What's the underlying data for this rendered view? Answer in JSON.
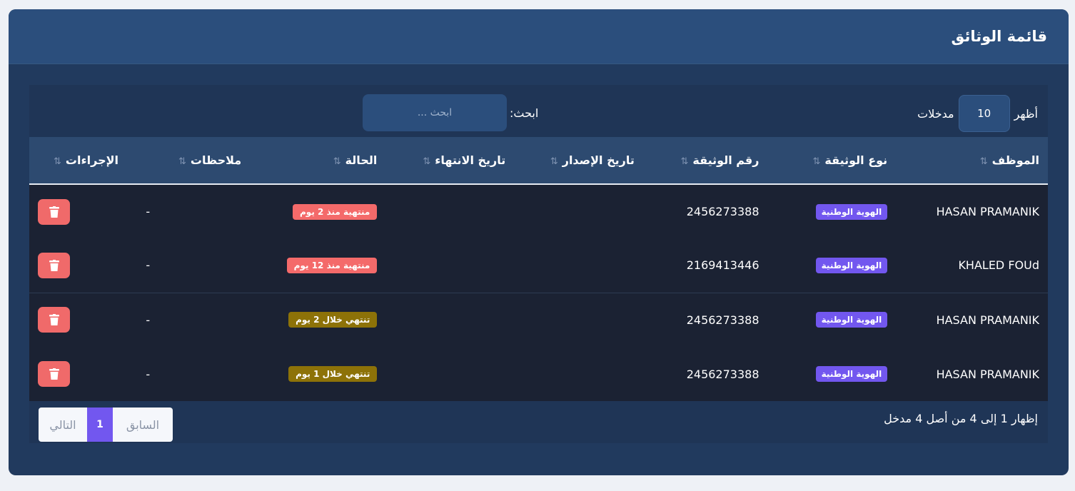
{
  "header": {
    "title": "قائمة الوثائق"
  },
  "controls": {
    "show_label": "أظهر",
    "page_length": "10",
    "entries_label": "مدخلات",
    "search_label": "ابحث:",
    "search_placeholder": "ابحث ..."
  },
  "table": {
    "columns": [
      "الموظف",
      "نوع الوثيقة",
      "رقم الوثيقة",
      "تاريخ الإصدار",
      "تاريخ الانتهاء",
      "الحالة",
      "ملاحظات",
      "الإجراءات"
    ],
    "sort_icon": "⇅",
    "rows": [
      {
        "employee": "HASAN PRAMANIK",
        "doc_type": "الهوية الوطنية",
        "doc_number": "2456273388",
        "issue_date": "",
        "expiry_date": "",
        "status": "منتهية منذ 2 يوم",
        "notes": "-"
      },
      {
        "employee": "KHALED FOUd",
        "doc_type": "الهوية الوطنية",
        "doc_number": "2169413446",
        "issue_date": "",
        "expiry_date": "",
        "status": "منتهية منذ 12 يوم",
        "notes": "-"
      },
      {
        "employee": "HASAN PRAMANIK",
        "doc_type": "الهوية الوطنية",
        "doc_number": "2456273388",
        "issue_date": "",
        "expiry_date": "",
        "status": "تنتهي خلال 2 يوم",
        "notes": "-"
      },
      {
        "employee": "HASAN PRAMANIK",
        "doc_type": "الهوية الوطنية",
        "doc_number": "2456273388",
        "issue_date": "",
        "expiry_date": "",
        "status": "تنتهي خلال 1 يوم",
        "notes": "-"
      }
    ]
  },
  "footer": {
    "info": "إظهار 1 إلى 4 من أصل 4 مدخل",
    "prev": "السابق",
    "current_page": "1",
    "next": "التالي"
  },
  "colors": {
    "expired": "#f46a6a",
    "expiring": "#8d7208",
    "accent": "#7257ef",
    "delete": "#f06a6a"
  },
  "icons": {
    "delete": "trash-icon",
    "sort": "sort-icon"
  }
}
